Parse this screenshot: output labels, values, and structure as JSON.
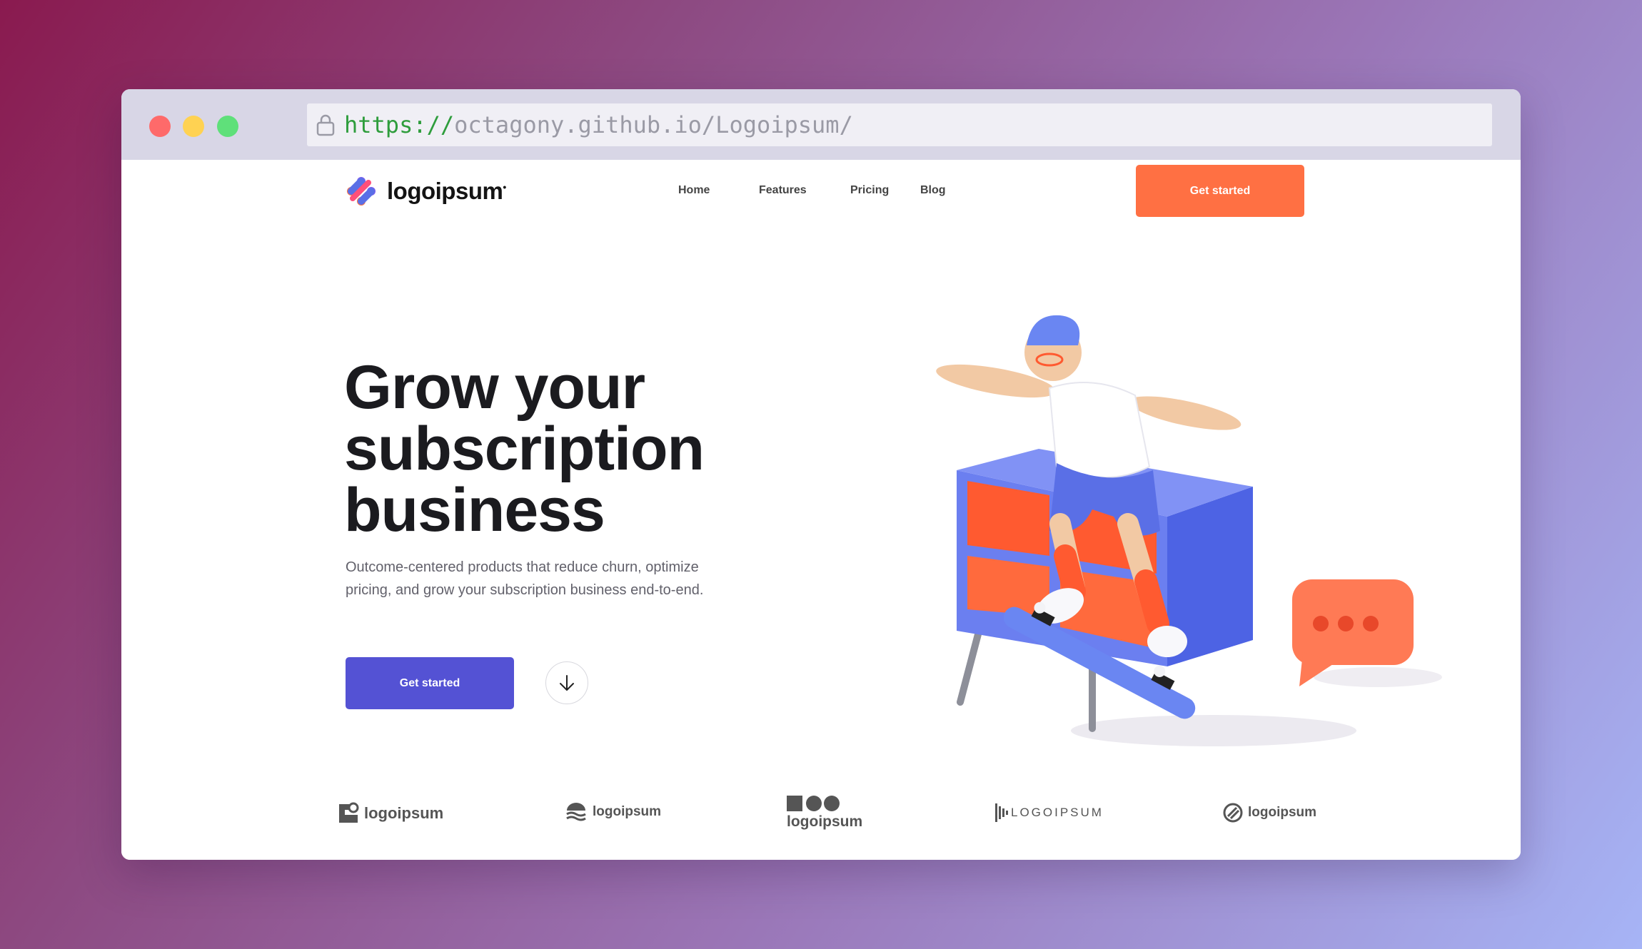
{
  "browser": {
    "url_scheme": "https://",
    "url_rest": "octagony.github.io/Logoipsum/"
  },
  "header": {
    "brand": "logoipsum",
    "nav": [
      "Home",
      "Features",
      "Pricing",
      "Blog"
    ],
    "cta": "Get started"
  },
  "hero": {
    "title": "Grow your subscription business",
    "subtitle": "Outcome-centered products that reduce churn, optimize pricing, and grow your subscription business end-to-end.",
    "cta": "Get started"
  },
  "partners": [
    "logoipsum",
    "logoipsum",
    "logoipsum",
    "LOGOIPSUM",
    "logoipsum"
  ],
  "colors": {
    "accent_orange": "#ff7043",
    "accent_purple": "#5452d4",
    "shelf_blue": "#5a6fe6",
    "shelf_orange": "#ff5a30"
  }
}
